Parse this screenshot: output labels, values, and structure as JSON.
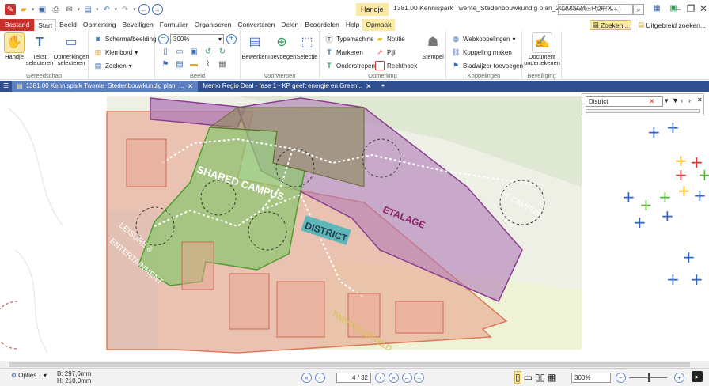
{
  "title_bar": {
    "context_tab": "Handje",
    "window_title": "1381.00 Kennispark Twente_Stedenbouwkundig plan_20200924 - PDF-X...",
    "quick_search_placeholder": "Snelstarten (CTRL+.)"
  },
  "ribbon_tabs": [
    "Bestand",
    "Start",
    "Beeld",
    "Opmerking",
    "Beveiligen",
    "Formulier",
    "Organiseren",
    "Converteren",
    "Delen",
    "Beoordelen",
    "Help",
    "Opmaak"
  ],
  "ribbon_tabs_right": {
    "find": "Zoeken...",
    "advanced_find": "Uitgebreid zoeken..."
  },
  "ribbon": {
    "tools": {
      "hand": "Handje",
      "select_text": "Tekst selecteren",
      "select_comments": "Opmerkingen selecteren",
      "label": "Gereedschap"
    },
    "snapshot": "Schermafbeelding",
    "clipboard": "Klembord",
    "find": "Zoeken",
    "zoom_value": "300%",
    "view_label": "Beeld",
    "objects": {
      "edit": "Bewerken",
      "add": "Toevoegen",
      "select": "Selectie",
      "label": "Voorwerpen"
    },
    "annotations": {
      "typewriter": "Typemachine",
      "note": "Notitie",
      "highlight": "Markeren",
      "arrow": "Pijl",
      "underline": "Onderstrepen",
      "rectangle": "Rechthoek",
      "stamp": "Stempel",
      "label": "Opmerking"
    },
    "links": {
      "web_links": "Webkoppelingen",
      "create_link": "Koppeling maken",
      "bookmark_add": "Bladwijzer toevoegen",
      "label": "Koppelingen"
    },
    "security": {
      "sign": "Document ondertekenen",
      "label": "Beveiliging"
    }
  },
  "doc_tabs": [
    {
      "label": "1381.00 Kennispark Twente_Stedenbouwkundig plan_..."
    },
    {
      "label": "Memo Regio Deal - fase 1 - KP geeft energie en Green..."
    }
  ],
  "find_panel": {
    "query": "District"
  },
  "map_labels": {
    "shared_campus": "SHARED CAMPUS",
    "district": "DISTRICT",
    "etalage": "ETALAGE",
    "ut_campus": "UT CAMPUS",
    "leisure": "LEISURE &",
    "entertainment": "ENTERTAINMENT",
    "tekkelerveld": "TWEKKELERVELD"
  },
  "status": {
    "options": "Opties...",
    "page_width": "B: 297,0mm",
    "page_height": "H: 210,0mm",
    "page_position": "4 / 32",
    "zoom": "300%"
  },
  "colors": {
    "file_tab": "#c9302c",
    "doc_tab_bar": "#2f4f8f",
    "green_zone": "#8fc672",
    "purple_zone": "#b07ab5",
    "salmon_zone": "#e8a48f",
    "teal_label": "#5fb6b8"
  }
}
